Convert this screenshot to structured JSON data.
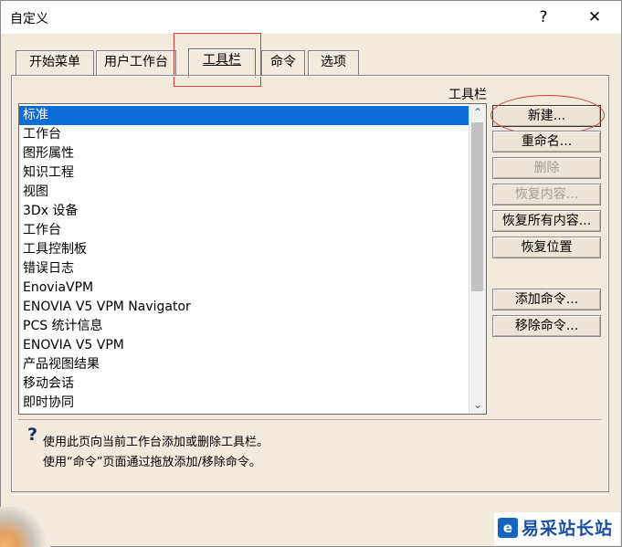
{
  "window": {
    "title": "自定义",
    "help_glyph": "?",
    "close_glyph": "✕"
  },
  "tabs": [
    {
      "label": "开始菜单"
    },
    {
      "label": "用户工作台"
    },
    {
      "label": "工具栏",
      "active": true
    },
    {
      "label": "命令"
    },
    {
      "label": "选项"
    }
  ],
  "toolbar_group_label": "工具栏",
  "toolbars_list": [
    "标准",
    "工作台",
    "图形属性",
    "知识工程",
    "视图",
    "3Dx 设备",
    "工作台",
    "工具控制板",
    "错误日志",
    "EnoviaVPM",
    "ENOVIA V5 VPM Navigator",
    "PCS 统计信息",
    "ENOVIA V5 VPM",
    "产品视图结果",
    "移动会话",
    "即时协同"
  ],
  "selected_item": "标准",
  "buttons": {
    "new": "新建...",
    "rename": "重命名...",
    "delete": "删除",
    "restore": "恢复内容...",
    "restore_all": "恢复所有内容...",
    "restore_position": "恢复位置",
    "add_command": "添加命令...",
    "remove_command": "移除命令..."
  },
  "help": {
    "icon": "?",
    "line1": "使用此页向当前工作台添加或删除工具栏。",
    "line2": "使用“命令”页面通过拖放添加/移除命令。"
  },
  "watermark": {
    "logo": "e",
    "text": "易采站长站"
  },
  "colors": {
    "selection": "#0a6ed6",
    "annotation": "#e03a3a",
    "dialog_bg": "#f2eadb"
  }
}
